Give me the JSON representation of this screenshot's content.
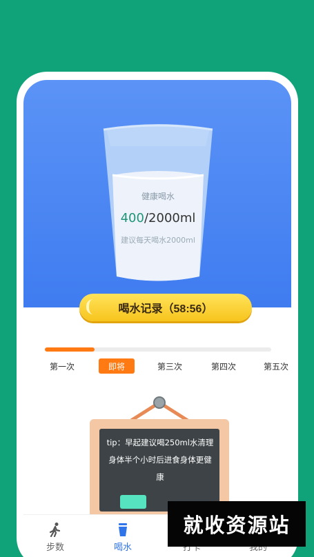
{
  "cup": {
    "title": "健康喝水",
    "current": "400",
    "total": "/2000ml",
    "hint": "建议每天喝水2000ml"
  },
  "record_button": {
    "label": "喝水记录（58:56）"
  },
  "progress": {
    "fraction": 0.22
  },
  "steps": [
    "第一次",
    "即将",
    "第三次",
    "第四次",
    "第五次"
  ],
  "tip": {
    "text": "tip：早起建议喝250ml水清理身体半个小时后进食身体更健康"
  },
  "nav": [
    {
      "label": "步数",
      "icon": "walk-icon"
    },
    {
      "label": "喝水",
      "icon": "cup-icon"
    },
    {
      "label": "打卡",
      "icon": "checkin-icon"
    },
    {
      "label": "我的",
      "icon": "user-icon"
    }
  ],
  "watermark": "就收资源站",
  "colors": {
    "accent": "#ff7a12",
    "primary": "#2f74e8",
    "background": "#10a37a"
  }
}
